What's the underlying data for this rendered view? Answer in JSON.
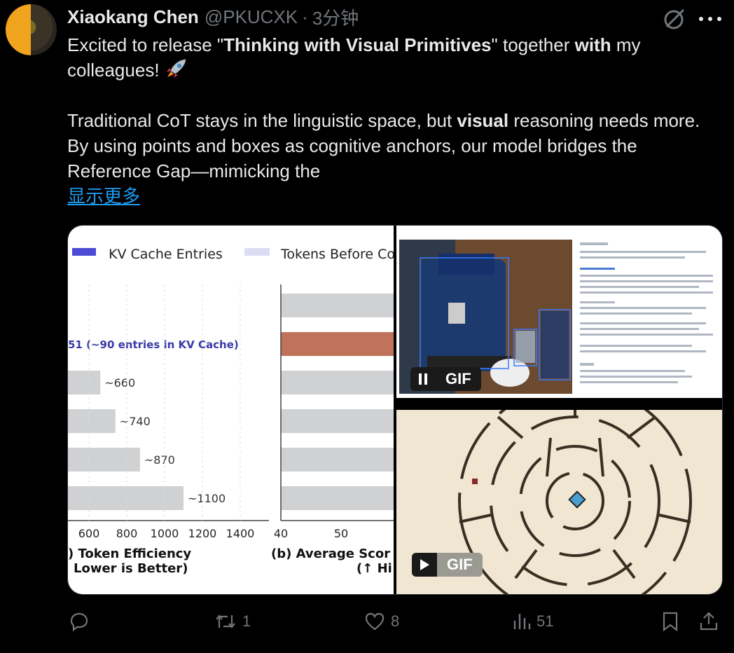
{
  "tweet": {
    "author_name": "Xiaokang Chen",
    "handle": "@PKUCXK",
    "separator": "·",
    "time": "3分钟",
    "body": {
      "p1_a": "Excited to release \"",
      "p1_b": "Thinking with Visual Primitives",
      "p1_c": "\" together ",
      "p1_d": "with",
      "p1_e": " my colleagues! ",
      "p2_a": "Traditional CoT stays in the linguistic space, but ",
      "p2_b": "visual",
      "p2_c": " reasoning needs more. By using points and boxes as cognitive anchors, our model bridges the Reference Gap—mimicking the",
      "show_more": "显示更多"
    },
    "icons": {
      "avatar": "avatar",
      "grok": "grok-icon",
      "more": "more-icon",
      "rocket": "rocket-emoji-icon"
    }
  },
  "media": {
    "gif_label_1": "GIF",
    "gif_label_2": "GIF",
    "chart_data": [
      {
        "type": "bar",
        "legend": [
          "KV Cache Entries",
          "Tokens Before Co"
        ],
        "annotation": "51 (~90 entries in KV Cache)",
        "categories": [
          "",
          "",
          "",
          ""
        ],
        "values": [
          660,
          740,
          870,
          1100
        ],
        "data_labels": [
          "~660",
          "~740",
          "~870",
          "~1100"
        ],
        "xticks": [
          "600",
          "800",
          "1000",
          "1200",
          "1400"
        ],
        "xlabel_line1": ") Token Efficiency",
        "xlabel_line2": "Lower is Better)",
        "bar_color": "#cfd1d3"
      },
      {
        "type": "bar",
        "xticks": [
          "40",
          "50"
        ],
        "xlabel_line1": "(b) Average Scor",
        "xlabel_line2": "(↑ Hi",
        "highlight_color": "#c0735a",
        "bar_color": "#cfd1d3"
      }
    ]
  },
  "actions": {
    "reply_count": "",
    "retweet_count": "1",
    "like_count": "8",
    "views_count": "51"
  }
}
